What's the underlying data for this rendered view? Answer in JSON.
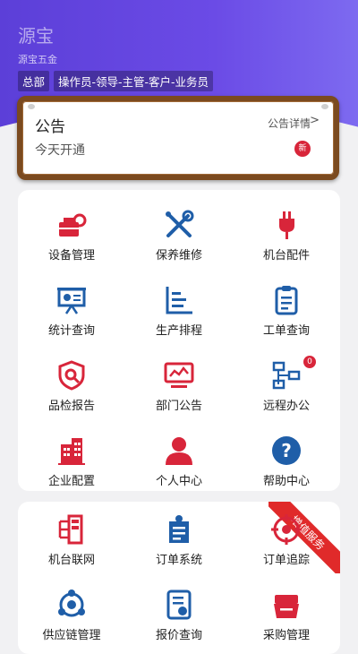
{
  "header": {
    "app_title": "源宝",
    "company": "源宝五金",
    "chips": [
      "总部",
      "操作员-领导-主管-客户-业务员"
    ]
  },
  "notice": {
    "title": "公告",
    "detail": "公告详情",
    "arrow": ">",
    "text": "今天开通",
    "badge": "新"
  },
  "menu1": [
    {
      "label": "设备管理",
      "icon": "equipment-icon"
    },
    {
      "label": "保养维修",
      "icon": "tools-icon"
    },
    {
      "label": "机台配件",
      "icon": "plug-icon"
    },
    {
      "label": "统计查询",
      "icon": "presentation-icon"
    },
    {
      "label": "生产排程",
      "icon": "bar-chart-icon"
    },
    {
      "label": "工单查询",
      "icon": "clipboard-icon"
    },
    {
      "label": "品检报告",
      "icon": "shield-search-icon"
    },
    {
      "label": "部门公告",
      "icon": "monitor-chart-icon"
    },
    {
      "label": "远程办公",
      "icon": "network-icon",
      "badge": "0"
    },
    {
      "label": "企业配置",
      "icon": "building-icon"
    },
    {
      "label": "个人中心",
      "icon": "person-icon"
    },
    {
      "label": "帮助中心",
      "icon": "help-icon"
    }
  ],
  "menu2": {
    "ribbon": "增值服务",
    "items": [
      {
        "label": "机台联网",
        "icon": "machine-network-icon"
      },
      {
        "label": "订单系统",
        "icon": "order-icon"
      },
      {
        "label": "订单追踪",
        "icon": "target-icon"
      },
      {
        "label": "供应链管理",
        "icon": "supply-chain-icon"
      },
      {
        "label": "报价查询",
        "icon": "quote-icon"
      },
      {
        "label": "采购管理",
        "icon": "purchase-icon"
      }
    ]
  },
  "colors": {
    "red": "#d8253a",
    "blue": "#1f5ea8",
    "header": "#6b4be6"
  }
}
